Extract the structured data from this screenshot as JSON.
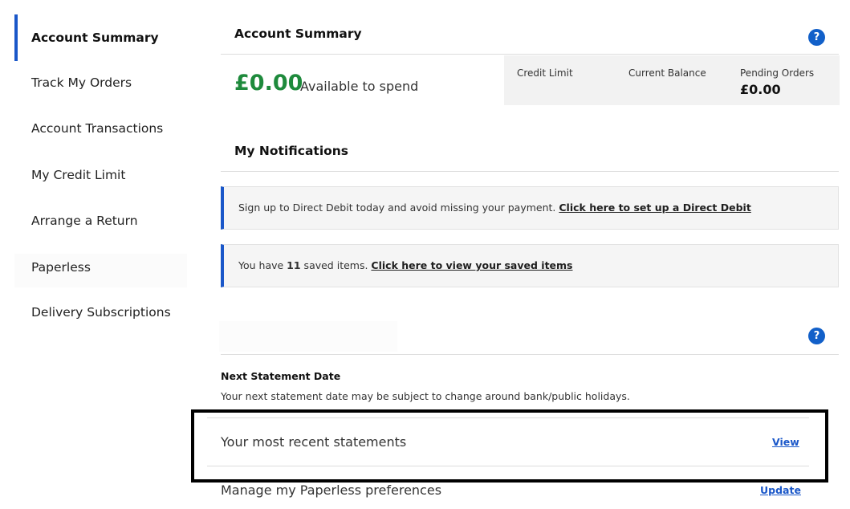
{
  "sidebar": {
    "items": [
      {
        "label": "Account Summary",
        "active": true
      },
      {
        "label": "Track My Orders"
      },
      {
        "label": "Account Transactions"
      },
      {
        "label": "My Credit Limit"
      },
      {
        "label": "Arrange a Return"
      },
      {
        "label": "Paperless"
      },
      {
        "label": "Delivery Subscriptions"
      }
    ]
  },
  "summary": {
    "title": "Account Summary",
    "help_icon": "?",
    "amount": "£0.00",
    "amount_label": "Available to spend",
    "credit_limit_label": "Credit Limit",
    "current_balance_label": "Current Balance",
    "pending_orders_label": "Pending Orders",
    "pending_orders_value": "£0.00"
  },
  "notifications": {
    "title": "My Notifications",
    "direct_debit": {
      "text": "Sign up to Direct Debit today and avoid missing your payment. ",
      "link": "Click here to set up a Direct Debit"
    },
    "saved_items": {
      "prefix": "You have ",
      "count": "11",
      "suffix": " saved items. ",
      "link": "Click here to view your saved items"
    }
  },
  "statements": {
    "help_icon": "?",
    "next_date_title": "Next Statement Date",
    "next_date_text": "Your next statement date may be subject to change around bank/public holidays.",
    "recent_label": "Your most recent statements",
    "recent_link": "View",
    "paperless_label": "Manage my Paperless preferences",
    "paperless_link": "Update"
  },
  "colors": {
    "accent": "#1a57c9",
    "amount_green": "#1e8a3c",
    "help_icon_blue": "#1260c9"
  }
}
